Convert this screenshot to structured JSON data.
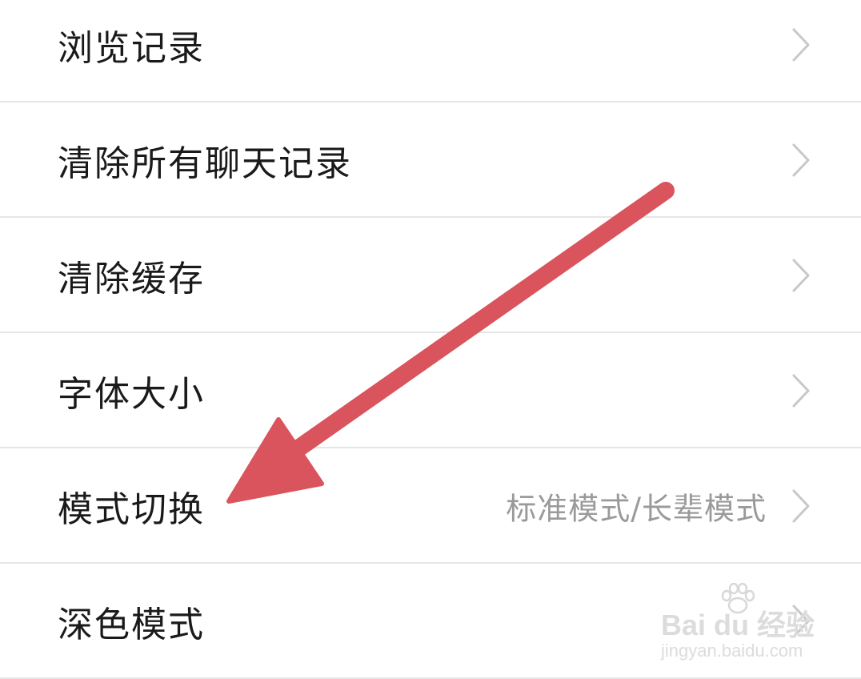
{
  "settings": {
    "items": [
      {
        "label": "浏览记录",
        "value": ""
      },
      {
        "label": "清除所有聊天记录",
        "value": ""
      },
      {
        "label": "清除缓存",
        "value": ""
      },
      {
        "label": "字体大小",
        "value": ""
      },
      {
        "label": "模式切换",
        "value": "标准模式/长辈模式"
      },
      {
        "label": "深色模式",
        "value": ""
      }
    ]
  },
  "icons": {
    "row_trailing": "chevron-right-icon",
    "annotation": "red-arrow-icon"
  },
  "colors": {
    "background": "#ffffff",
    "text_primary": "#1a1a1a",
    "text_secondary": "#9a9a9a",
    "chevron": "#c8c8c8",
    "divider": "#e6e6e6",
    "arrow": "#d9545c"
  },
  "watermark": {
    "logo": "Bai du 经验",
    "url": "jingyan.baidu.com"
  }
}
